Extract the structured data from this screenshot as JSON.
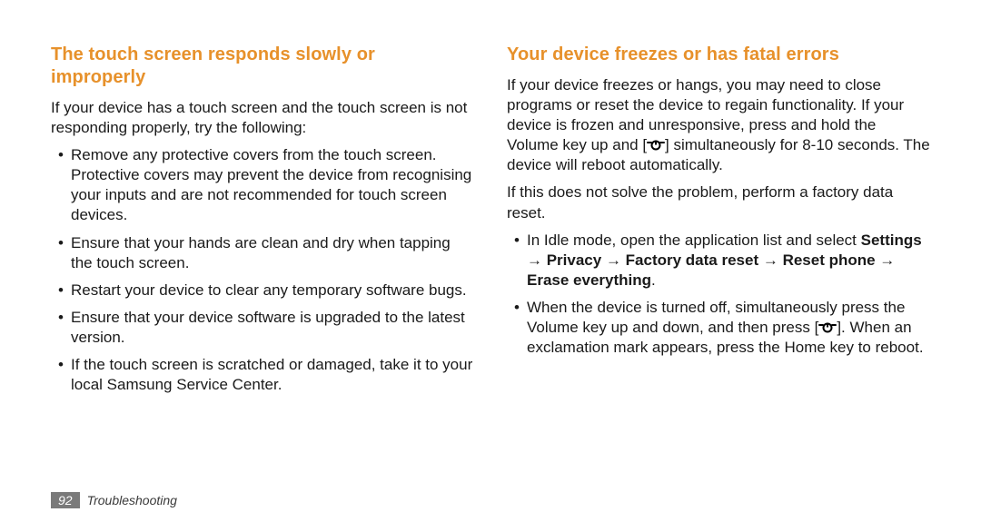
{
  "left": {
    "heading": "The touch screen responds slowly or improperly",
    "intro": "If your device has a touch screen and the touch screen is not responding properly, try the following:",
    "bullets": [
      "Remove any protective covers from the touch screen. Protective covers may prevent the device from recognising your inputs and are not recommended for touch screen devices.",
      "Ensure that your hands are clean and dry when tapping the touch screen.",
      "Restart your device to clear any temporary software bugs.",
      "Ensure that your device software is upgraded to the latest version.",
      "If the touch screen is scratched or damaged, take it to your local Samsung Service Center."
    ]
  },
  "right": {
    "heading": "Your device freezes or has fatal errors",
    "para1_pre": "If your device freezes or hangs, you may need to close programs or reset the device to regain functionality. If your device is frozen and unresponsive, press and hold the Volume key up and [",
    "para1_post": "] simultaneously for 8-10 seconds. The device will reboot automatically.",
    "para2": "If this does not solve the problem, perform a factory data reset.",
    "bullet1_pre": "In Idle mode, open the application list and select ",
    "bullet1_bold": "Settings → Privacy → Factory data reset → Reset phone → Erase everything",
    "bullet1_post": ".",
    "bullet2_pre": "When the device is turned off, simultaneously press the Volume key up and down, and then press [",
    "bullet2_post": "]. When an exclamation mark appears, press the Home key to reboot."
  },
  "footer": {
    "page_num": "92",
    "section": "Troubleshooting"
  }
}
